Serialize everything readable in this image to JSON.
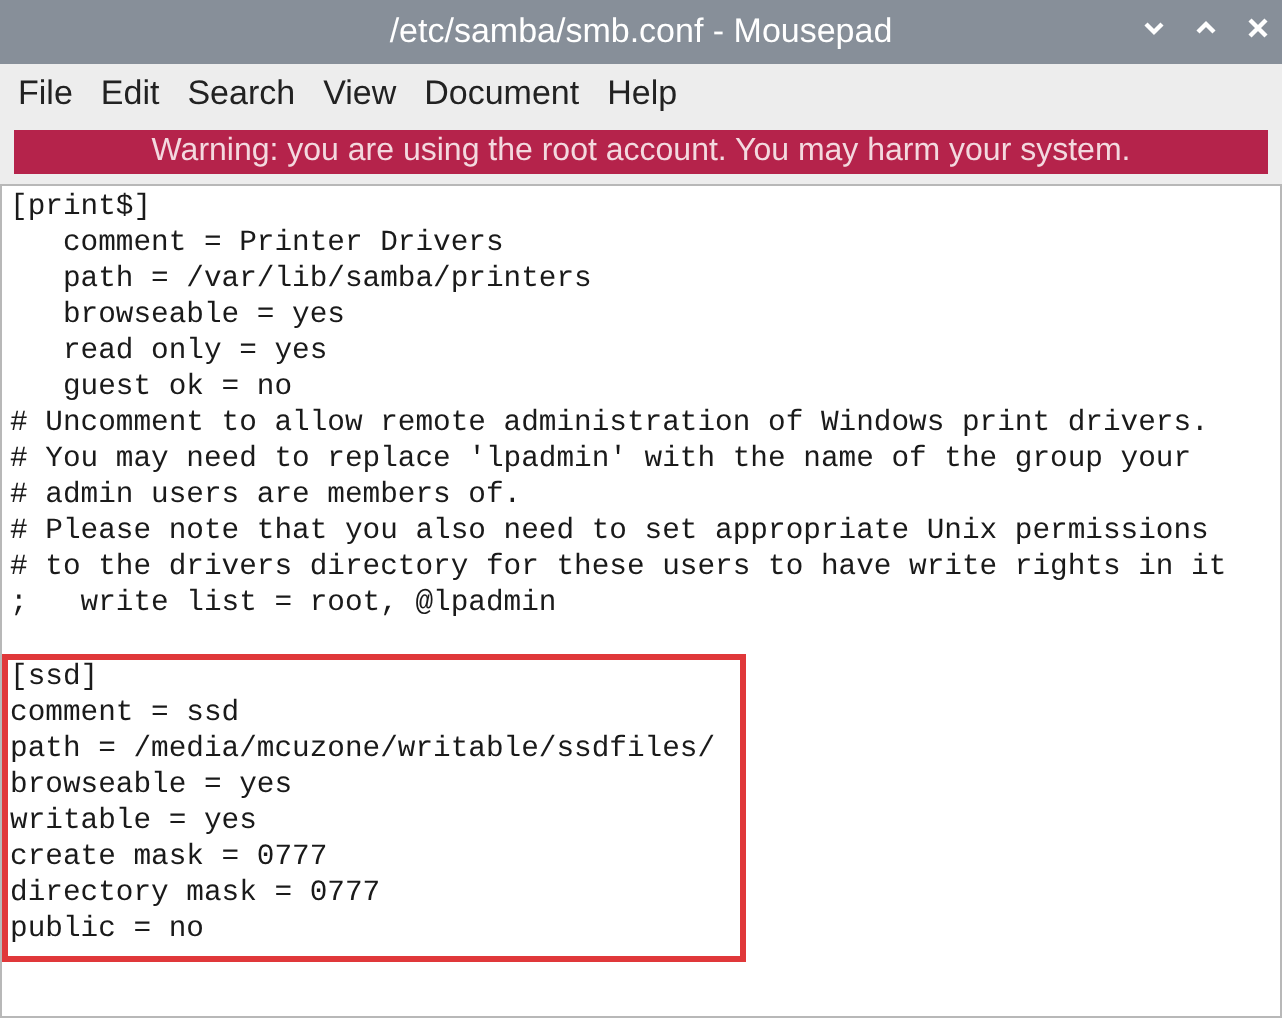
{
  "window": {
    "title": "/etc/samba/smb.conf - Mousepad"
  },
  "menu": [
    "File",
    "Edit",
    "Search",
    "View",
    "Document",
    "Help"
  ],
  "warning": "Warning: you are using the root account. You may harm your system.",
  "editor": {
    "sections": [
      {
        "highlighted": false,
        "lines": [
          "[print$]",
          "   comment = Printer Drivers",
          "   path = /var/lib/samba/printers",
          "   browseable = yes",
          "   read only = yes",
          "   guest ok = no",
          "# Uncomment to allow remote administration of Windows print drivers.",
          "# You may need to replace 'lpadmin' with the name of the group your",
          "# admin users are members of.",
          "# Please note that you also need to set appropriate Unix permissions",
          "# to the drivers directory for these users to have write rights in it",
          ";   write list = root, @lpadmin"
        ]
      },
      {
        "highlighted": true,
        "lines": [
          "[ssd]",
          "comment = ssd",
          "path = /media/mcuzone/writable/ssdfiles/",
          "browseable = yes",
          "writable = yes",
          "create mask = 0777",
          "directory mask = 0777",
          "public = no"
        ]
      }
    ]
  }
}
